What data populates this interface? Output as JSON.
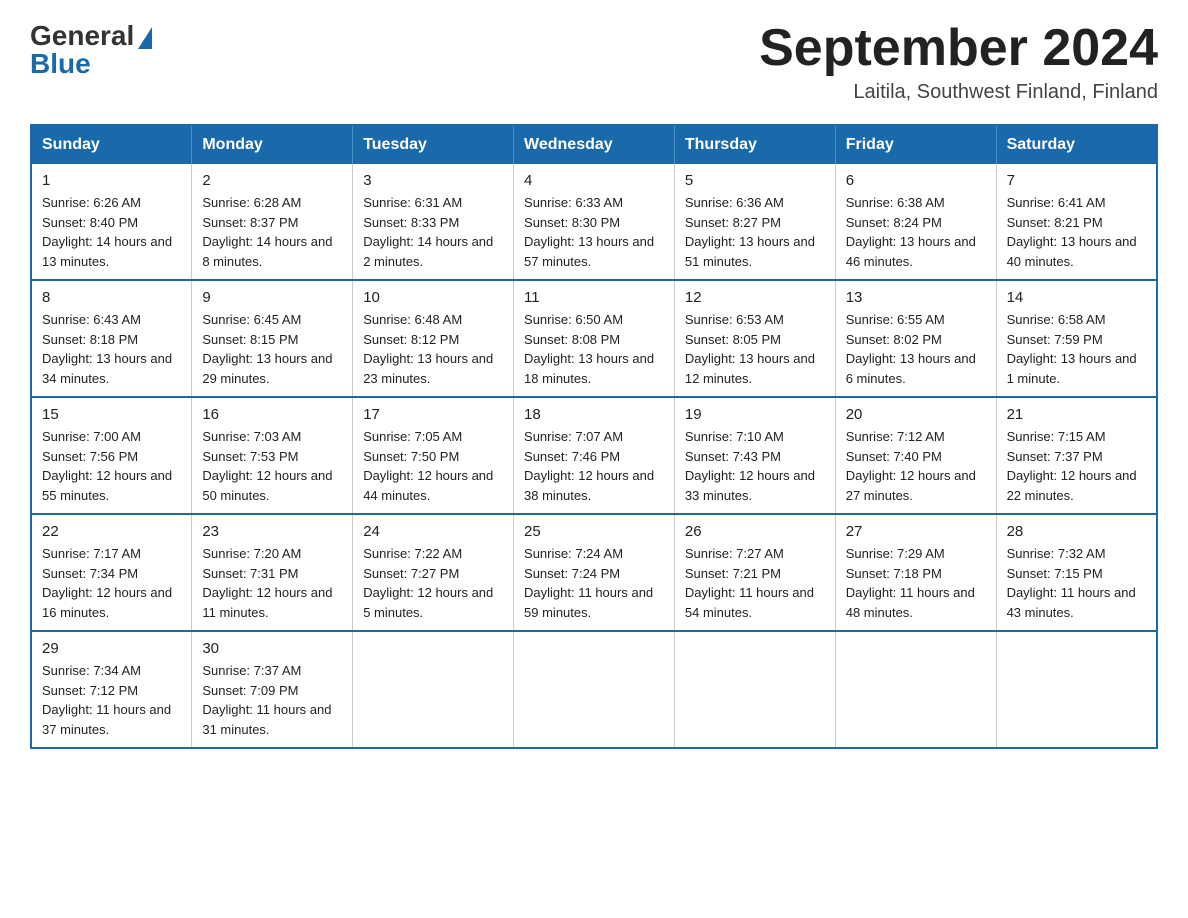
{
  "logo": {
    "general": "General",
    "blue": "Blue"
  },
  "header": {
    "month_year": "September 2024",
    "location": "Laitila, Southwest Finland, Finland"
  },
  "weekdays": [
    "Sunday",
    "Monday",
    "Tuesday",
    "Wednesday",
    "Thursday",
    "Friday",
    "Saturday"
  ],
  "weeks": [
    [
      {
        "day": "1",
        "sunrise": "Sunrise: 6:26 AM",
        "sunset": "Sunset: 8:40 PM",
        "daylight": "Daylight: 14 hours and 13 minutes."
      },
      {
        "day": "2",
        "sunrise": "Sunrise: 6:28 AM",
        "sunset": "Sunset: 8:37 PM",
        "daylight": "Daylight: 14 hours and 8 minutes."
      },
      {
        "day": "3",
        "sunrise": "Sunrise: 6:31 AM",
        "sunset": "Sunset: 8:33 PM",
        "daylight": "Daylight: 14 hours and 2 minutes."
      },
      {
        "day": "4",
        "sunrise": "Sunrise: 6:33 AM",
        "sunset": "Sunset: 8:30 PM",
        "daylight": "Daylight: 13 hours and 57 minutes."
      },
      {
        "day": "5",
        "sunrise": "Sunrise: 6:36 AM",
        "sunset": "Sunset: 8:27 PM",
        "daylight": "Daylight: 13 hours and 51 minutes."
      },
      {
        "day": "6",
        "sunrise": "Sunrise: 6:38 AM",
        "sunset": "Sunset: 8:24 PM",
        "daylight": "Daylight: 13 hours and 46 minutes."
      },
      {
        "day": "7",
        "sunrise": "Sunrise: 6:41 AM",
        "sunset": "Sunset: 8:21 PM",
        "daylight": "Daylight: 13 hours and 40 minutes."
      }
    ],
    [
      {
        "day": "8",
        "sunrise": "Sunrise: 6:43 AM",
        "sunset": "Sunset: 8:18 PM",
        "daylight": "Daylight: 13 hours and 34 minutes."
      },
      {
        "day": "9",
        "sunrise": "Sunrise: 6:45 AM",
        "sunset": "Sunset: 8:15 PM",
        "daylight": "Daylight: 13 hours and 29 minutes."
      },
      {
        "day": "10",
        "sunrise": "Sunrise: 6:48 AM",
        "sunset": "Sunset: 8:12 PM",
        "daylight": "Daylight: 13 hours and 23 minutes."
      },
      {
        "day": "11",
        "sunrise": "Sunrise: 6:50 AM",
        "sunset": "Sunset: 8:08 PM",
        "daylight": "Daylight: 13 hours and 18 minutes."
      },
      {
        "day": "12",
        "sunrise": "Sunrise: 6:53 AM",
        "sunset": "Sunset: 8:05 PM",
        "daylight": "Daylight: 13 hours and 12 minutes."
      },
      {
        "day": "13",
        "sunrise": "Sunrise: 6:55 AM",
        "sunset": "Sunset: 8:02 PM",
        "daylight": "Daylight: 13 hours and 6 minutes."
      },
      {
        "day": "14",
        "sunrise": "Sunrise: 6:58 AM",
        "sunset": "Sunset: 7:59 PM",
        "daylight": "Daylight: 13 hours and 1 minute."
      }
    ],
    [
      {
        "day": "15",
        "sunrise": "Sunrise: 7:00 AM",
        "sunset": "Sunset: 7:56 PM",
        "daylight": "Daylight: 12 hours and 55 minutes."
      },
      {
        "day": "16",
        "sunrise": "Sunrise: 7:03 AM",
        "sunset": "Sunset: 7:53 PM",
        "daylight": "Daylight: 12 hours and 50 minutes."
      },
      {
        "day": "17",
        "sunrise": "Sunrise: 7:05 AM",
        "sunset": "Sunset: 7:50 PM",
        "daylight": "Daylight: 12 hours and 44 minutes."
      },
      {
        "day": "18",
        "sunrise": "Sunrise: 7:07 AM",
        "sunset": "Sunset: 7:46 PM",
        "daylight": "Daylight: 12 hours and 38 minutes."
      },
      {
        "day": "19",
        "sunrise": "Sunrise: 7:10 AM",
        "sunset": "Sunset: 7:43 PM",
        "daylight": "Daylight: 12 hours and 33 minutes."
      },
      {
        "day": "20",
        "sunrise": "Sunrise: 7:12 AM",
        "sunset": "Sunset: 7:40 PM",
        "daylight": "Daylight: 12 hours and 27 minutes."
      },
      {
        "day": "21",
        "sunrise": "Sunrise: 7:15 AM",
        "sunset": "Sunset: 7:37 PM",
        "daylight": "Daylight: 12 hours and 22 minutes."
      }
    ],
    [
      {
        "day": "22",
        "sunrise": "Sunrise: 7:17 AM",
        "sunset": "Sunset: 7:34 PM",
        "daylight": "Daylight: 12 hours and 16 minutes."
      },
      {
        "day": "23",
        "sunrise": "Sunrise: 7:20 AM",
        "sunset": "Sunset: 7:31 PM",
        "daylight": "Daylight: 12 hours and 11 minutes."
      },
      {
        "day": "24",
        "sunrise": "Sunrise: 7:22 AM",
        "sunset": "Sunset: 7:27 PM",
        "daylight": "Daylight: 12 hours and 5 minutes."
      },
      {
        "day": "25",
        "sunrise": "Sunrise: 7:24 AM",
        "sunset": "Sunset: 7:24 PM",
        "daylight": "Daylight: 11 hours and 59 minutes."
      },
      {
        "day": "26",
        "sunrise": "Sunrise: 7:27 AM",
        "sunset": "Sunset: 7:21 PM",
        "daylight": "Daylight: 11 hours and 54 minutes."
      },
      {
        "day": "27",
        "sunrise": "Sunrise: 7:29 AM",
        "sunset": "Sunset: 7:18 PM",
        "daylight": "Daylight: 11 hours and 48 minutes."
      },
      {
        "day": "28",
        "sunrise": "Sunrise: 7:32 AM",
        "sunset": "Sunset: 7:15 PM",
        "daylight": "Daylight: 11 hours and 43 minutes."
      }
    ],
    [
      {
        "day": "29",
        "sunrise": "Sunrise: 7:34 AM",
        "sunset": "Sunset: 7:12 PM",
        "daylight": "Daylight: 11 hours and 37 minutes."
      },
      {
        "day": "30",
        "sunrise": "Sunrise: 7:37 AM",
        "sunset": "Sunset: 7:09 PM",
        "daylight": "Daylight: 11 hours and 31 minutes."
      },
      null,
      null,
      null,
      null,
      null
    ]
  ]
}
